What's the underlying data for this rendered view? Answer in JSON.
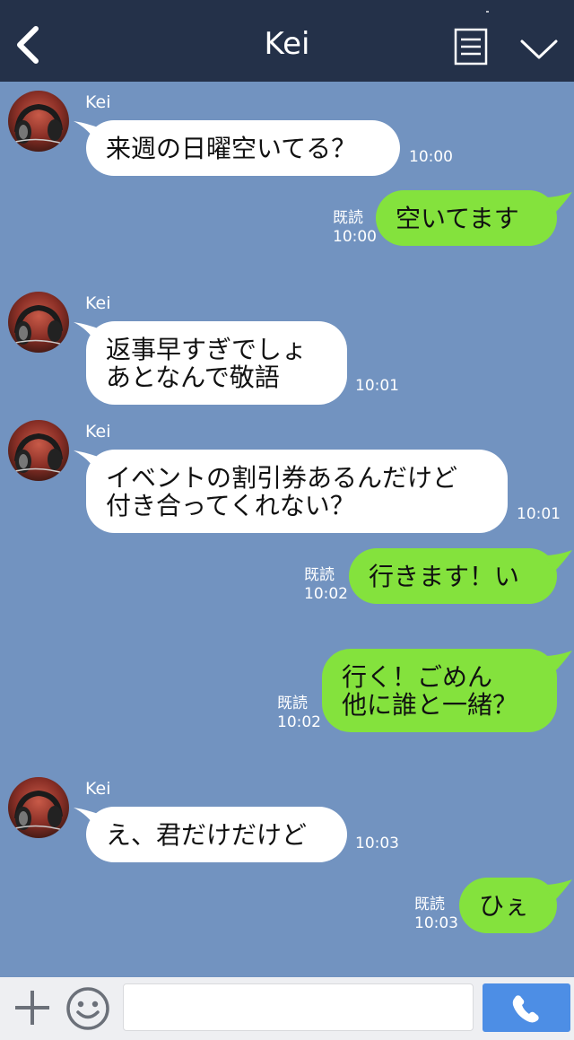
{
  "header": {
    "title": "Kei",
    "back_icon": "chevron-left-icon",
    "menu_icon": "document-menu-icon",
    "collapse_icon": "chevron-down-icon"
  },
  "messages": [
    {
      "type": "in",
      "sender": "Kei",
      "text": "来週の日曜空いてる？",
      "time": "10:00"
    },
    {
      "type": "out",
      "read": "既読",
      "text": "空いてます",
      "time": "10:00"
    },
    {
      "type": "in",
      "sender": "Kei",
      "text": "返事早すぎでしょ\nあとなんで敬語",
      "time": "10:01"
    },
    {
      "type": "in",
      "sender": "Kei",
      "text": "イベントの割引券あるんだけど\n付き合ってくれない？",
      "time": "10:01"
    },
    {
      "type": "out",
      "read": "既読",
      "text": "行きます！い",
      "time": "10:02"
    },
    {
      "type": "out",
      "read": "既読",
      "text": "行く！ごめん\n他に誰と一緒？",
      "time": "10:02"
    },
    {
      "type": "in",
      "sender": "Kei",
      "text": "え、君だけだけど",
      "time": "10:03"
    },
    {
      "type": "out",
      "read": "既読",
      "text": "ひぇ",
      "time": "10:03"
    }
  ],
  "footer": {
    "input_value": "",
    "add_icon": "plus-icon",
    "emoji_icon": "smiley-icon",
    "call_icon": "phone-icon"
  },
  "colors": {
    "header_bg": "#243149",
    "chat_bg": "#7293c0",
    "incoming_bubble": "#ffffff",
    "outgoing_bubble": "#84e23d",
    "send_button": "#4d8ee5"
  }
}
